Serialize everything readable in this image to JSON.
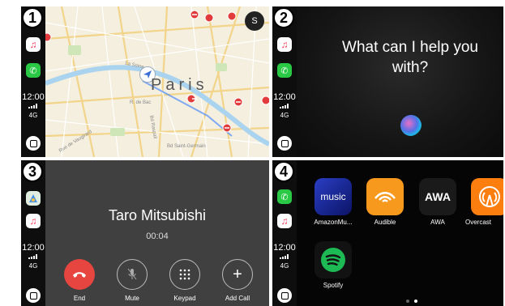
{
  "panels": [
    {
      "number": "1",
      "kind": "maps"
    },
    {
      "number": "2",
      "kind": "siri"
    },
    {
      "number": "3",
      "kind": "phone-call"
    },
    {
      "number": "4",
      "kind": "app-grid"
    }
  ],
  "dock": {
    "time": "12:00",
    "network": "4G"
  },
  "map": {
    "city_label": "Paris",
    "profile_initial": "S",
    "street_labels": [
      "La Seine",
      "Rue de Vaugirard",
      "Bd Raspail",
      "R. de Bac",
      "Bd Saint-Germain"
    ]
  },
  "siri": {
    "prompt": "What can I help you with?"
  },
  "call": {
    "caller_name": "Taro Mitsubishi",
    "duration": "00:04",
    "buttons": [
      {
        "label": "End",
        "icon": "phone-hangup-icon"
      },
      {
        "label": "Mute",
        "icon": "microphone-icon"
      },
      {
        "label": "Keypad",
        "icon": "keypad-icon"
      },
      {
        "label": "Add Call",
        "icon": "plus-icon"
      }
    ]
  },
  "apps": {
    "items": [
      {
        "label": "AmazonMu...",
        "tile_text": "music",
        "color": "#1a2a8c"
      },
      {
        "label": "Audible",
        "tile_text": "",
        "color": "#f7991c"
      },
      {
        "label": "AWA",
        "tile_text": "AWA",
        "color": "#1a1a1a"
      },
      {
        "label": "Overcast",
        "tile_text": "",
        "color": "#fc7e0f"
      },
      {
        "label": "Spotify",
        "tile_text": "",
        "color": "#1db954"
      }
    ],
    "page_dots": {
      "count": 2,
      "active": 1
    }
  },
  "colors": {
    "end_call_red": "#e64540",
    "phone_green": "#29c946",
    "music_pink": "#fa3a5e"
  }
}
